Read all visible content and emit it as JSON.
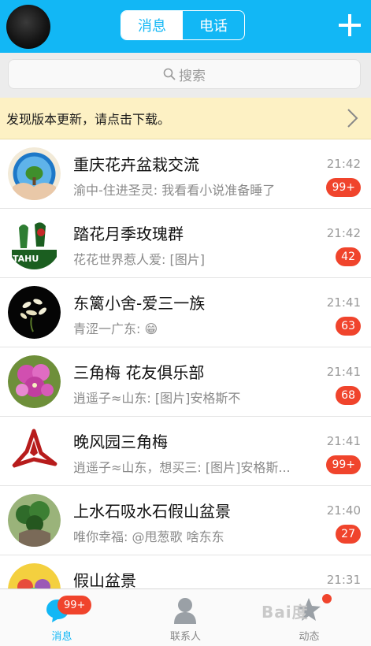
{
  "colors": {
    "brand": "#12b7f5",
    "badge": "#f0442c",
    "notice_bg": "#fdf1c4"
  },
  "header": {
    "tabs": [
      {
        "label": "消息",
        "active": true
      },
      {
        "label": "电话",
        "active": false
      }
    ],
    "plus_icon": "plus-icon"
  },
  "search": {
    "placeholder": "搜索",
    "icon": "search-icon"
  },
  "update_notice": {
    "text": "发现版本更新，请点击下载。",
    "icon": "chevron-right-icon"
  },
  "conversations": [
    {
      "name": "重庆花卉盆栽交流",
      "preview": "渝中-住进圣灵: 我看看小说准备睡了",
      "time": "21:42",
      "badge": "99+"
    },
    {
      "name": "踏花月季玫瑰群",
      "preview": "花花世界惹人爱: [图片]",
      "time": "21:42",
      "badge": "42"
    },
    {
      "name": "东篱小舍-爱三一族",
      "preview": "青涩一广东: 😁",
      "time": "21:41",
      "badge": "63"
    },
    {
      "name": "三角梅 花友俱乐部",
      "preview": "逍遥子≈山东: [图片]安格斯不",
      "time": "21:41",
      "badge": "68"
    },
    {
      "name": "晚风园三角梅",
      "preview": "逍遥子≈山东，想买三: [图片]安格斯...",
      "time": "21:41",
      "badge": "99+"
    },
    {
      "name": "上水石吸水石假山盆景",
      "preview": "唯你幸福: @甩葱歌 啥东东",
      "time": "21:40",
      "badge": "27"
    },
    {
      "name": "假山盆景",
      "preview": "",
      "time": "21:31",
      "badge": ""
    }
  ],
  "tabbar": {
    "items": [
      {
        "label": "消息",
        "active": true,
        "icon": "message-bubble-icon",
        "badge": "99+"
      },
      {
        "label": "联系人",
        "active": false,
        "icon": "contacts-icon"
      },
      {
        "label": "动态",
        "active": false,
        "icon": "star-icon"
      }
    ]
  },
  "avatar_logo_text": "TAHU",
  "watermark": "Bai度"
}
